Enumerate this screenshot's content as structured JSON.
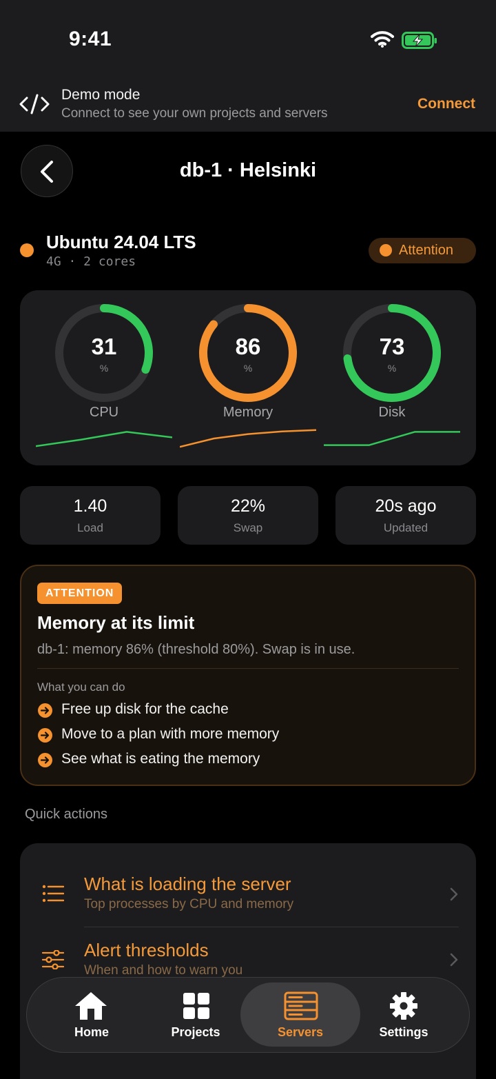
{
  "status_bar": {
    "time": "9:41"
  },
  "demo_banner": {
    "title": "Demo mode",
    "subtitle": "Connect to see your own projects and servers",
    "action": "Connect"
  },
  "header": {
    "title": "db-1 · Helsinki"
  },
  "server": {
    "os": "Ubuntu 24.04 LTS",
    "specs": "4G · 2 cores",
    "status": "Attention",
    "status_color": "#f5922f"
  },
  "gauges": [
    {
      "label": "CPU",
      "value": "31",
      "unit": "%",
      "fraction": 0.31,
      "color": "#34c759",
      "trend": [
        0.15,
        0.45,
        0.8,
        0.55
      ]
    },
    {
      "label": "Memory",
      "value": "86",
      "unit": "%",
      "fraction": 0.86,
      "color": "#f5922f",
      "trend": [
        0.12,
        0.5,
        0.7,
        0.82,
        0.88
      ]
    },
    {
      "label": "Disk",
      "value": "73",
      "unit": "%",
      "fraction": 0.73,
      "color": "#34c759",
      "trend": [
        0.2,
        0.2,
        0.8,
        0.8
      ]
    }
  ],
  "stats": [
    {
      "value": "1.40",
      "label": "Load"
    },
    {
      "value": "22%",
      "label": "Swap"
    },
    {
      "value": "20s ago",
      "label": "Updated"
    }
  ],
  "alert": {
    "tag": "ATTENTION",
    "title": "Memory at its limit",
    "message": "db-1: memory 86% (threshold 80%). Swap is in use.",
    "actions_heading": "What you can do",
    "actions": [
      "Free up disk for the cache",
      "Move to a plan with more memory",
      "See what is eating the memory"
    ]
  },
  "quick_actions": {
    "heading": "Quick actions",
    "items": [
      {
        "title": "What is loading the server",
        "subtitle": "Top processes by CPU and memory",
        "icon": "list-icon"
      },
      {
        "title": "Alert thresholds",
        "subtitle": "When and how to warn you",
        "icon": "sliders-icon"
      }
    ]
  },
  "tab_bar": {
    "tabs": [
      {
        "label": "Home",
        "icon": "home-icon"
      },
      {
        "label": "Projects",
        "icon": "grid-icon"
      },
      {
        "label": "Servers",
        "icon": "server-icon",
        "active": true
      },
      {
        "label": "Settings",
        "icon": "gear-icon"
      }
    ],
    "active_color": "#f5922f"
  },
  "colors": {
    "accent": "#f5922f",
    "ok": "#34c759",
    "background": "#000000",
    "card": "#1c1c1e"
  }
}
